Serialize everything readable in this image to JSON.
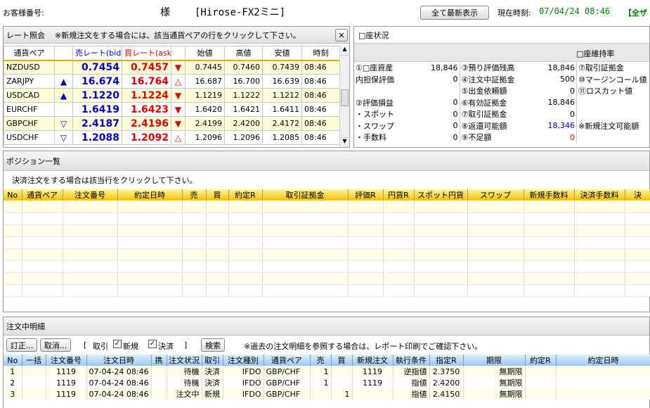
{
  "header": {
    "customer_label": "お客様番号:",
    "sama": "様",
    "app_name": "[Hirose-FX2ミニ]",
    "refresh_all": "全て最新表示",
    "time_label": "現在時刻:",
    "time_value": "07/04/24 08:46",
    "overflow_text": "【全ザ"
  },
  "rates": {
    "title": "レート照会",
    "hint": "※新規注文をする場合には、該当通貨ペアの行をクリックして下さい。",
    "headers": [
      "通貨ペア",
      "",
      "売レート(bid)",
      "買レート(ask)",
      "",
      "始値",
      "高値",
      "安値",
      "時刻"
    ],
    "rows": [
      {
        "pair": "NZDUSD",
        "up": "",
        "bid": "0.7454",
        "ask": "0.7457",
        "dn": "▼",
        "open": "0.7445",
        "high": "0.7460",
        "low": "0.7439",
        "time": "08:46"
      },
      {
        "pair": "ZARJPY",
        "up": "▲",
        "bid": "16.674",
        "ask": "16.764",
        "dn": "△",
        "open": "16.687",
        "high": "16.700",
        "low": "16.639",
        "time": "08:46"
      },
      {
        "pair": "USDCAD",
        "up": "▲",
        "bid": "1.1220",
        "ask": "1.1224",
        "dn": "▼",
        "open": "1.1219",
        "high": "1.1222",
        "low": "1.1212",
        "time": "08:46"
      },
      {
        "pair": "EURCHF",
        "up": "",
        "bid": "1.6419",
        "ask": "1.6423",
        "dn": "▼",
        "open": "1.6420",
        "high": "1.6421",
        "low": "1.6411",
        "time": "08:46"
      },
      {
        "pair": "GBPCHF",
        "up": "▽",
        "bid": "2.4187",
        "ask": "2.4196",
        "dn": "▼",
        "open": "2.4199",
        "high": "2.4200",
        "low": "2.4172",
        "time": "08:46"
      },
      {
        "pair": "USDCHF",
        "up": "▽",
        "bid": "1.2088",
        "ask": "1.2092",
        "dn": "△",
        "open": "1.2096",
        "high": "1.2096",
        "low": "1.2085",
        "time": "08:46"
      }
    ]
  },
  "account": {
    "title": "□座状況",
    "maint_label": "□座維持率",
    "col1": [
      {
        "label": "①□座資産",
        "value": "18,846"
      },
      {
        "label": "内担保評価",
        "value": "0"
      },
      {
        "label": "",
        "value": ""
      },
      {
        "label": "②評価損益",
        "value": "0"
      },
      {
        "label": "・スポット",
        "value": "0"
      },
      {
        "label": "・スワップ",
        "value": "0"
      },
      {
        "label": "・手数料",
        "value": "0"
      }
    ],
    "col2": [
      {
        "label": "③預り評価残高",
        "value": "18,846"
      },
      {
        "label": "④注文中証拠金",
        "value": "500"
      },
      {
        "label": "⑤出金依頼額",
        "value": "0"
      },
      {
        "label": "⑥有効証拠金",
        "value": "18,846"
      },
      {
        "label": "⑦取引証拠金",
        "value": "0"
      },
      {
        "label": "⑧返還可能額",
        "value": "18,346"
      },
      {
        "label": "⑨不足額",
        "value": "0"
      }
    ],
    "col3": [
      {
        "label": "⑦取引証拠金"
      },
      {
        "label": "⑩マージンコール値"
      },
      {
        "label": "⑪ロスカット値"
      },
      {
        "label": ""
      },
      {
        "label": ""
      },
      {
        "label": "※新規注文可能額"
      },
      {
        "label": ""
      }
    ]
  },
  "positions": {
    "title": "ポジション一覧",
    "hint": "決済注文をする場合は該当行をクリックして下さい。",
    "headers": [
      "No",
      "通貨ペア",
      "注文番号",
      "約定日時",
      "売",
      "買",
      "約定R",
      "取引証拠金",
      "評価R",
      "円貨R",
      "スポット円貨",
      "スワップ",
      "新規手数料",
      "決済手数料",
      "決"
    ]
  },
  "orders": {
    "title": "注文中明細",
    "btn_edit": "訂正...",
    "btn_cancel": "取消...",
    "bracket_open": "[",
    "filter_label": "取引",
    "chk_new": "新規",
    "chk_settle": "決済",
    "bracket_close": "]",
    "btn_search": "検索",
    "hint": "※過去の注文明細を参照する場合は、レポート印刷でご確認下さい。",
    "headers": [
      "No",
      "一括",
      "注文番号",
      "注文日時",
      "携",
      "注文状況",
      "取引",
      "注文種別",
      "通貨ペア",
      "売",
      "買",
      "新規注文",
      "執行条件",
      "指定R",
      "期限",
      "約定R",
      "約定日時"
    ],
    "rows": [
      {
        "no": "1",
        "bulk": "",
        "num": "1119",
        "dt": "07-04-24 08:46",
        "k": "",
        "status": "待機",
        "trade": "決済",
        "type": "IFDO",
        "pair": "GBP/CHF",
        "sell": "1",
        "buy": "",
        "neworder": "1119",
        "cond": "逆指値",
        "rate": "2.3750",
        "limit": "無期限",
        "er": "",
        "edt": ""
      },
      {
        "no": "2",
        "bulk": "",
        "num": "1119",
        "dt": "07-04-24 08:46",
        "k": "",
        "status": "待機",
        "trade": "決済",
        "type": "IFDO",
        "pair": "GBP/CHF",
        "sell": "1",
        "buy": "",
        "neworder": "1119",
        "cond": "指値",
        "rate": "2.4200",
        "limit": "無期限",
        "er": "",
        "edt": ""
      },
      {
        "no": "3",
        "bulk": "",
        "num": "1119",
        "dt": "07-04-24 08:46",
        "k": "",
        "status": "注文中",
        "trade": "新規",
        "type": "IFDO",
        "pair": "GBP/CHF",
        "sell": "",
        "buy": "1",
        "neworder": "",
        "cond": "指値",
        "rate": "2.4150",
        "limit": "無期限",
        "er": "",
        "edt": ""
      }
    ]
  },
  "colors": {
    "bid": "#0000cc",
    "ask": "#e00000",
    "accent": "#f2c200",
    "time": "#008000"
  }
}
